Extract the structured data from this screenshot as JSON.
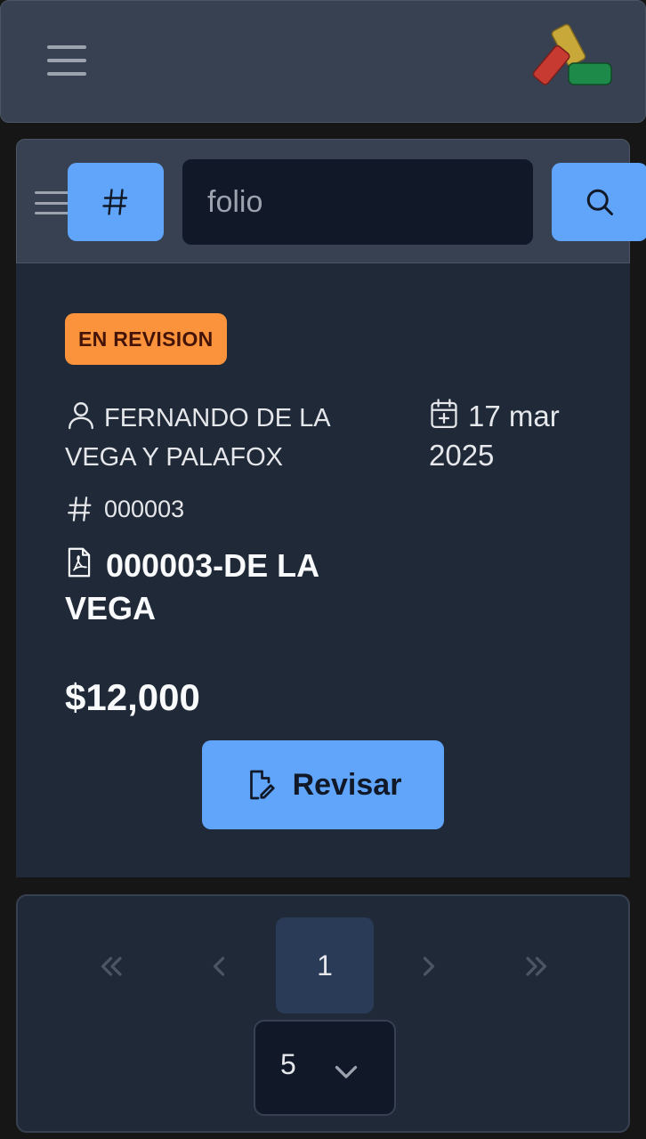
{
  "header": {
    "menu_icon": "hamburger-menu-icon",
    "logo": "tricolor-brand-logo",
    "logo_colors": [
      "#c63a32",
      "#c9a83a",
      "#1e8a4a"
    ]
  },
  "search": {
    "hash_icon": "hash-icon",
    "placeholder": "folio",
    "value": "",
    "search_icon": "search-icon"
  },
  "record": {
    "status": "EN REVISION",
    "status_color": "#fb923c",
    "person_icon": "user-icon",
    "person_name": "FERNANDO DE LA VEGA Y PALAFOX",
    "date_icon": "calendar-plus-icon",
    "date": "17 mar 2025",
    "folio_icon": "hash-icon",
    "folio": "000003",
    "file_icon": "pdf-file-icon",
    "file_name": "000003-DE LA VEGA",
    "amount": "$12,000",
    "action_icon": "edit-document-icon",
    "action_label": "Revisar"
  },
  "pagination": {
    "current_page": "1",
    "page_size": "5",
    "first_icon": "double-chevron-left-icon",
    "prev_icon": "chevron-left-icon",
    "next_icon": "chevron-right-icon",
    "last_icon": "double-chevron-right-icon",
    "dropdown_icon": "chevron-down-icon"
  },
  "colors": {
    "accent": "#60a5fa",
    "background": "#161616",
    "surface": "#1f2937",
    "header": "#374151"
  }
}
